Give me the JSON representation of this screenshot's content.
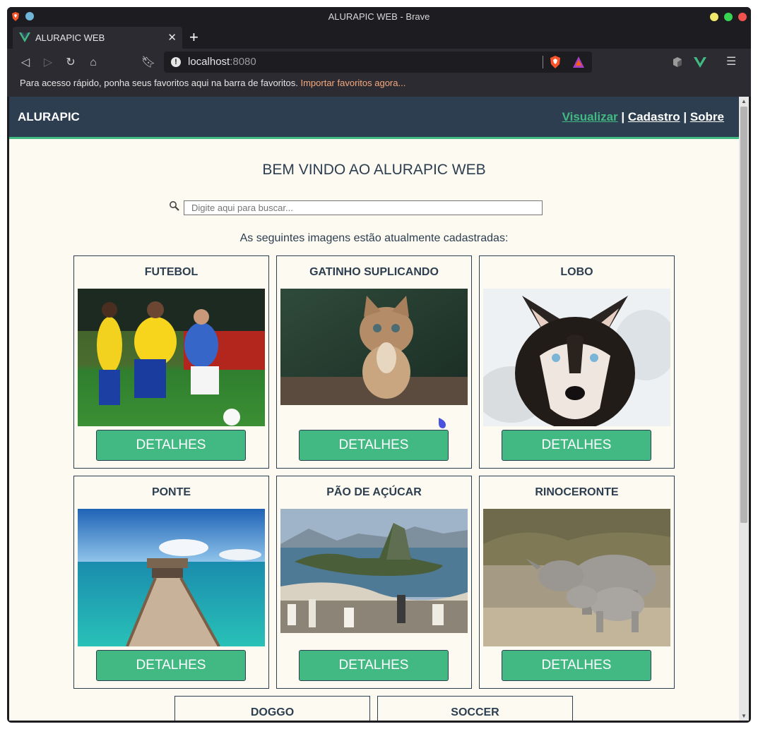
{
  "browser": {
    "window_title": "ALURAPIC WEB - Brave",
    "tab_title": "ALURAPIC WEB",
    "url_host": "localhost",
    "url_port": ":8080",
    "bookmarks_bar_text": "Para acesso rápido, ponha seus favoritos aqui na barra de favoritos.",
    "bookmarks_bar_link": "Importar favoritos agora...",
    "accent_colors": {
      "close": "#f2524d",
      "minimize": "#f2c94c",
      "maximize": "#39d353"
    }
  },
  "app": {
    "brand": "ALURAPIC",
    "nav": [
      {
        "label": "Visualizar",
        "active": true
      },
      {
        "label": "Cadastro",
        "active": false
      },
      {
        "label": "Sobre",
        "active": false
      }
    ],
    "nav_separator": "|",
    "welcome": "BEM VINDO AO ALURAPIC WEB",
    "search_placeholder": "Digite aqui para buscar...",
    "subtitle": "As seguintes imagens estão atualmente cadastradas:",
    "detail_button_label": "DETALHES",
    "colors": {
      "header": "#2c3e50",
      "accent": "#42b983",
      "background": "#fdfaf1"
    }
  },
  "cards": [
    {
      "title": "FUTEBOL",
      "image": "soccer-players-photo"
    },
    {
      "title": "GATINHO SUPLICANDO",
      "image": "kitten-begging-photo"
    },
    {
      "title": "LOBO",
      "image": "husky-wolf-photo"
    },
    {
      "title": "PONTE",
      "image": "pier-ocean-photo"
    },
    {
      "title": "PÃO DE AÇÚCAR",
      "image": "sugarloaf-mountain-photo"
    },
    {
      "title": "RINOCERONTE",
      "image": "rhinos-photo"
    },
    {
      "title": "DOGGO"
    },
    {
      "title": "SOCCER"
    }
  ]
}
